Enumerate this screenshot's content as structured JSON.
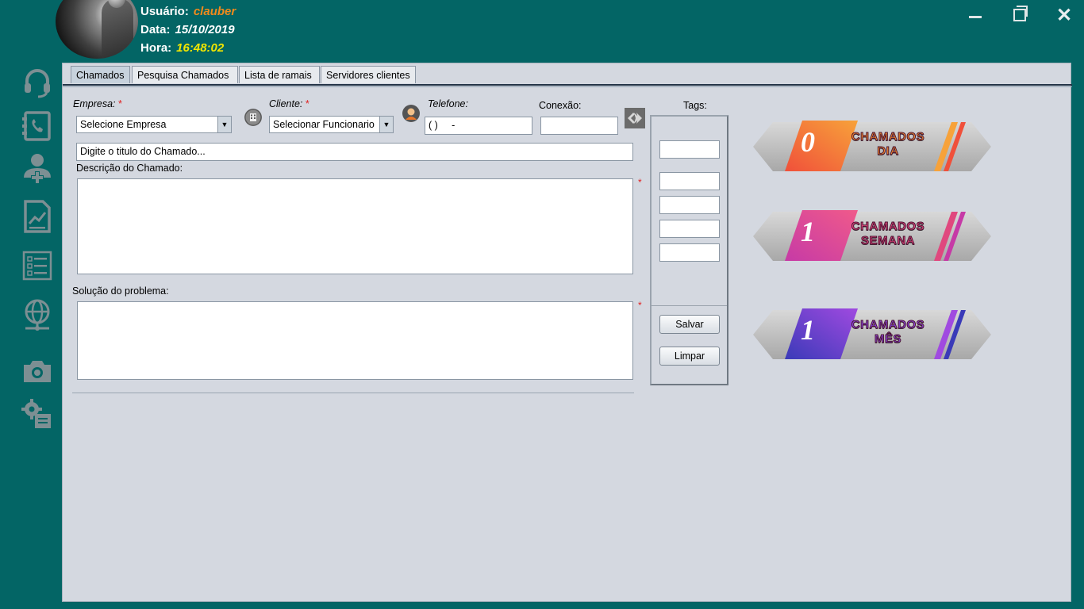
{
  "header": {
    "user_label": "Usuário:",
    "user_value": "clauber",
    "date_label": "Data:",
    "date_value": "15/10/2019",
    "time_label": "Hora:",
    "time_value": "16:48:02"
  },
  "window_controls": {
    "minimize": "minimize-icon",
    "maximize": "maximize-icon",
    "close": "close-icon"
  },
  "sidebar": [
    {
      "icon": "headset-icon"
    },
    {
      "icon": "phone-book-icon"
    },
    {
      "icon": "add-user-icon"
    },
    {
      "icon": "report-chart-icon"
    },
    {
      "icon": "checklist-icon"
    },
    {
      "icon": "network-globe-icon"
    },
    {
      "icon": "camera-icon"
    },
    {
      "icon": "settings-gear-icon"
    }
  ],
  "tabs": [
    "Chamados",
    "Pesquisa Chamados",
    "Lista de ramais",
    "Servidores clientes"
  ],
  "form": {
    "empresa_label": "Empresa:",
    "empresa_value": "Selecione Empresa",
    "cliente_label": "Cliente:",
    "cliente_value": "Selecionar Funcionario",
    "telefone_label": "Telefone:",
    "telefone_value": "( )     -",
    "conexao_label": "Conexão:",
    "conexao_value": "",
    "required_mark": "*",
    "titulo_placeholder": "Digite o titulo do Chamado...",
    "descricao_label": "Descrição do Chamado:",
    "solucao_label": "Solução do problema:"
  },
  "tags": {
    "label": "Tags:",
    "save_label": "Salvar",
    "clear_label": "Limpar"
  },
  "stats": [
    {
      "count": "0",
      "line1": "CHAMADOS",
      "line2": "DIA",
      "color_a": "#f0503a",
      "color_b": "#f7a23a",
      "text_color": "#f08a2c"
    },
    {
      "count": "1",
      "line1": "CHAMADOS",
      "line2": "SEMANA",
      "color_a": "#c63aa6",
      "color_b": "#f05a8a",
      "text_color": "#e0487e"
    },
    {
      "count": "1",
      "line1": "CHAMADOS",
      "line2": "MÊS",
      "color_a": "#3a3ab8",
      "color_b": "#a04ae0",
      "text_color": "#8a48e0"
    }
  ],
  "colors": {
    "background": "#036565",
    "panel": "#d4d8e0",
    "accent_user": "#f08a1c",
    "accent_time": "#f2e600"
  }
}
